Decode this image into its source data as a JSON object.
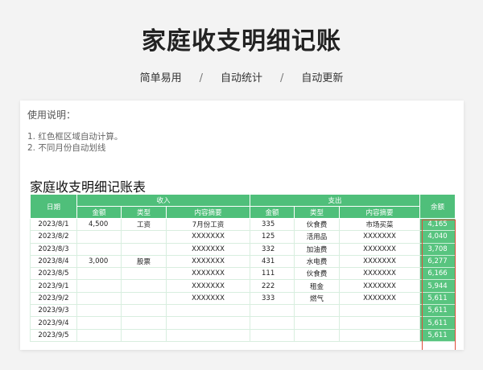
{
  "hero": {
    "title": "家庭收支明细记账",
    "tags": [
      "简单易用",
      "自动统计",
      "自动更新"
    ],
    "separator": "/"
  },
  "usage": {
    "title": "使用说明：",
    "lines": [
      "1. 红色框区域自动计算。",
      "2. 不同月份自动划线"
    ]
  },
  "sheet": {
    "title": "家庭收支明细记账表",
    "headers": {
      "date": "日期",
      "income": "收入",
      "expense": "支出",
      "balance": "余额",
      "amount": "金额",
      "type": "类型",
      "summary": "内容摘要"
    },
    "rows": [
      {
        "date": "2023/8/1",
        "inc_amt": "4,500",
        "inc_type": "工资",
        "inc_desc": "7月份工资",
        "exp_amt": "335",
        "exp_type": "伙食费",
        "exp_desc": "市场买菜",
        "balance": "4,165"
      },
      {
        "date": "2023/8/2",
        "inc_amt": "",
        "inc_type": "",
        "inc_desc": "XXXXXXX",
        "exp_amt": "125",
        "exp_type": "活用品",
        "exp_desc": "XXXXXXX",
        "balance": "4,040"
      },
      {
        "date": "2023/8/3",
        "inc_amt": "",
        "inc_type": "",
        "inc_desc": "XXXXXXX",
        "exp_amt": "332",
        "exp_type": "加油费",
        "exp_desc": "XXXXXXX",
        "balance": "3,708"
      },
      {
        "date": "2023/8/4",
        "inc_amt": "3,000",
        "inc_type": "股票",
        "inc_desc": "XXXXXXX",
        "exp_amt": "431",
        "exp_type": "水电费",
        "exp_desc": "XXXXXXX",
        "balance": "6,277"
      },
      {
        "date": "2023/8/5",
        "inc_amt": "",
        "inc_type": "",
        "inc_desc": "XXXXXXX",
        "exp_amt": "111",
        "exp_type": "伙食费",
        "exp_desc": "XXXXXXX",
        "balance": "6,166"
      },
      {
        "date": "2023/9/1",
        "inc_amt": "",
        "inc_type": "",
        "inc_desc": "XXXXXXX",
        "exp_amt": "222",
        "exp_type": "租金",
        "exp_desc": "XXXXXXX",
        "balance": "5,944"
      },
      {
        "date": "2023/9/2",
        "inc_amt": "",
        "inc_type": "",
        "inc_desc": "XXXXXXX",
        "exp_amt": "333",
        "exp_type": "燃气",
        "exp_desc": "XXXXXXX",
        "balance": "5,611"
      },
      {
        "date": "2023/9/3",
        "inc_amt": "",
        "inc_type": "",
        "inc_desc": "",
        "exp_amt": "",
        "exp_type": "",
        "exp_desc": "",
        "balance": "5,611"
      },
      {
        "date": "2023/9/4",
        "inc_amt": "",
        "inc_type": "",
        "inc_desc": "",
        "exp_amt": "",
        "exp_type": "",
        "exp_desc": "",
        "balance": "5,611"
      },
      {
        "date": "2023/9/5",
        "inc_amt": "",
        "inc_type": "",
        "inc_desc": "",
        "exp_amt": "",
        "exp_type": "",
        "exp_desc": "",
        "balance": "5,611"
      }
    ],
    "month_divider_before_row": 5,
    "colors": {
      "header_green": "#4fbf7a",
      "balance_green": "#58c47f",
      "highlight_box": "#e04d3a"
    }
  }
}
